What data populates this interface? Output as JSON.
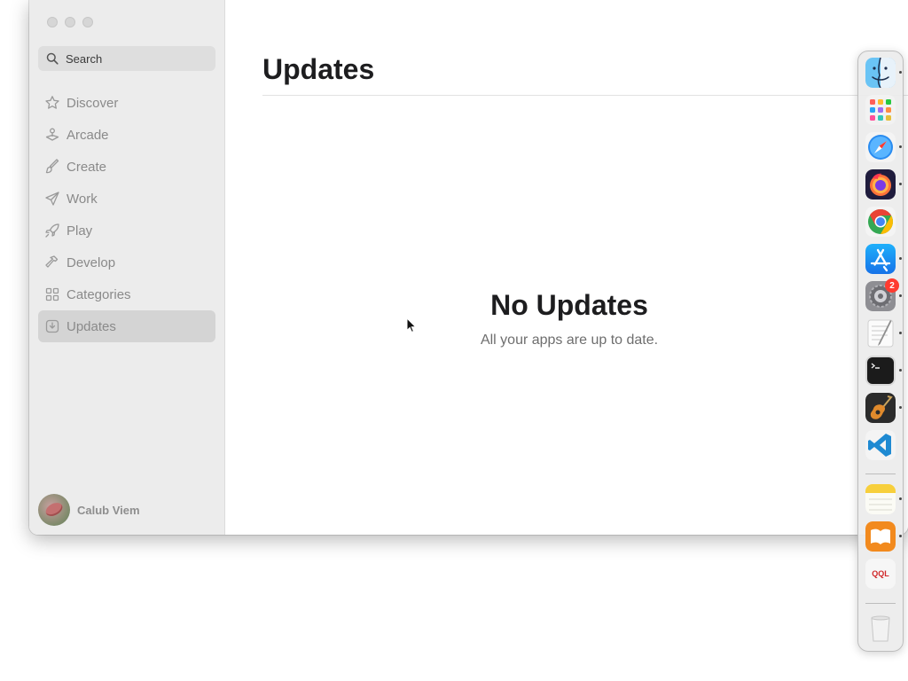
{
  "search": {
    "placeholder": "Search"
  },
  "sidebar": {
    "items": [
      {
        "label": "Discover",
        "icon": "star-icon"
      },
      {
        "label": "Arcade",
        "icon": "joystick-icon"
      },
      {
        "label": "Create",
        "icon": "paintbrush-icon"
      },
      {
        "label": "Work",
        "icon": "paperplane-icon"
      },
      {
        "label": "Play",
        "icon": "rocket-icon"
      },
      {
        "label": "Develop",
        "icon": "hammer-icon"
      },
      {
        "label": "Categories",
        "icon": "grid-icon"
      },
      {
        "label": "Updates",
        "icon": "download-icon",
        "selected": true
      }
    ]
  },
  "profile": {
    "name": "Calub Viem"
  },
  "main": {
    "title": "Updates",
    "empty_title": "No Updates",
    "empty_subtitle": "All your apps are up to date."
  },
  "dock": {
    "apps": [
      {
        "name": "Finder",
        "icon": "finder-icon",
        "running": true
      },
      {
        "name": "Launchpad",
        "icon": "launchpad-icon",
        "running": false
      },
      {
        "name": "Safari",
        "icon": "safari-icon",
        "running": true
      },
      {
        "name": "Firefox",
        "icon": "firefox-icon",
        "running": true
      },
      {
        "name": "Chrome",
        "icon": "chrome-icon",
        "running": false
      },
      {
        "name": "App Store",
        "icon": "app-store-icon",
        "running": true
      },
      {
        "name": "System Settings",
        "icon": "system-settings-icon",
        "running": true,
        "badge": "2"
      },
      {
        "name": "TextEdit",
        "icon": "textedit-icon",
        "running": true
      },
      {
        "name": "Terminal",
        "icon": "terminal-icon",
        "running": true
      },
      {
        "name": "GarageBand",
        "icon": "garageband-icon",
        "running": true
      },
      {
        "name": "Visual Studio Code",
        "icon": "vscode-icon",
        "running": false
      },
      {
        "name": "Notes",
        "icon": "notes-icon",
        "running": true
      },
      {
        "name": "Books",
        "icon": "books-icon",
        "running": true
      },
      {
        "name": "QQL",
        "icon": "qql-icon",
        "running": false,
        "label": "QQL"
      },
      {
        "name": "Trash",
        "icon": "trash-icon",
        "running": false
      }
    ]
  },
  "colors": {
    "sidebar_bg": "#ececec",
    "selected_bg": "#d4d4d4",
    "badge": "#ff3b30",
    "text_muted": "#8a8a8a"
  }
}
